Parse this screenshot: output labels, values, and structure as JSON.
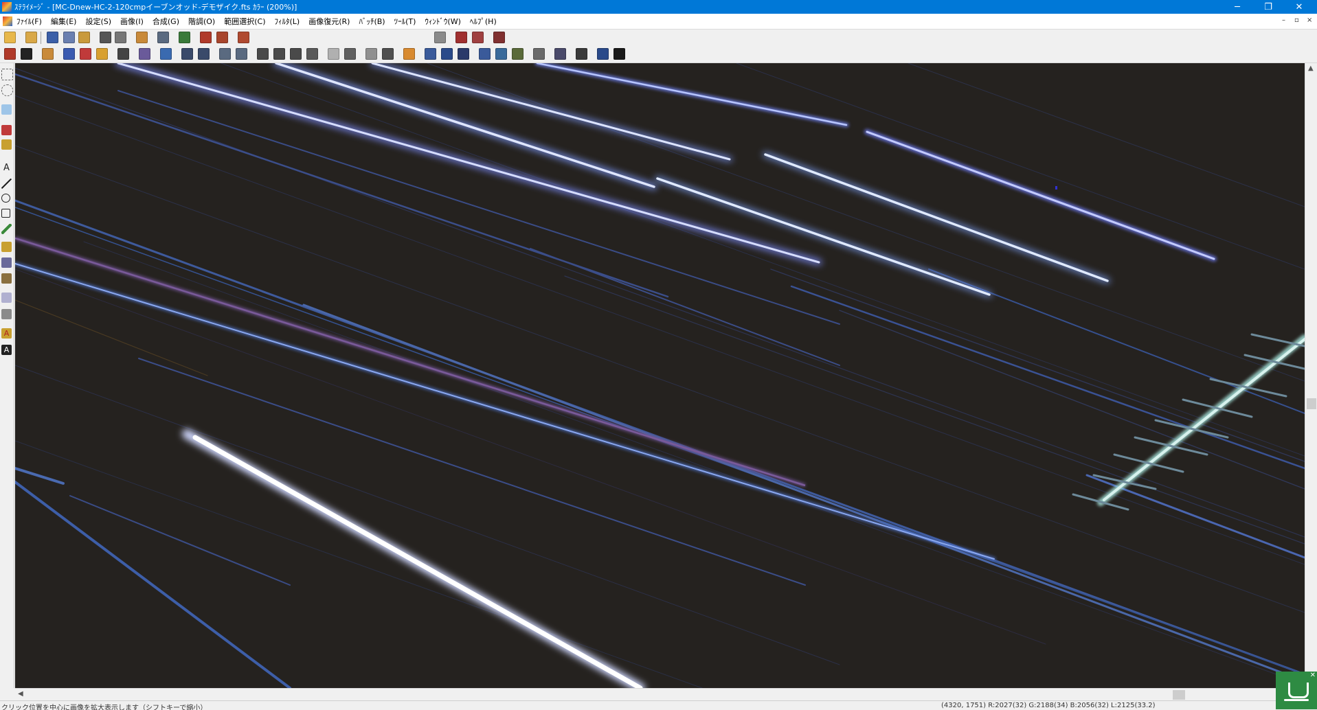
{
  "window": {
    "title": "ｽﾃﾗｲﾒｰｼﾞ - [MC-Dnew-HC-2-120cmpイーブンオッド-デモザイク.fts ｶﾗｰ (200%)]",
    "controls": {
      "minimize": "─",
      "restore": "❐",
      "close": "✕"
    },
    "mdi_controls": {
      "minimize": "–",
      "restore": "▫",
      "close": "×"
    }
  },
  "menu": [
    "ﾌｧｲﾙ(F)",
    "編集(E)",
    "設定(S)",
    "画像(I)",
    "合成(G)",
    "階調(O)",
    "範囲選択(C)",
    "ﾌｨﾙﾀ(L)",
    "画像復元(R)",
    "ﾊﾞｯﾁ(B)",
    "ﾂｰﾙ(T)",
    "ｳｨﾝﾄﾞｳ(W)",
    "ﾍﾙﾌﾟ(H)"
  ],
  "status": {
    "message": "クリック位置を中心に画像を拡大表示します（シフトキーで縮小）",
    "coordinates": "(4320, 1751) R:2027(32) G:2188(34) B:2056(32) L:2125(33.2)"
  },
  "colors": {
    "titlebar": "#0078d7",
    "canvas": "#25221f",
    "notification": "#2e8b43"
  },
  "icons": {
    "notification": "coffee-cup-icon"
  }
}
